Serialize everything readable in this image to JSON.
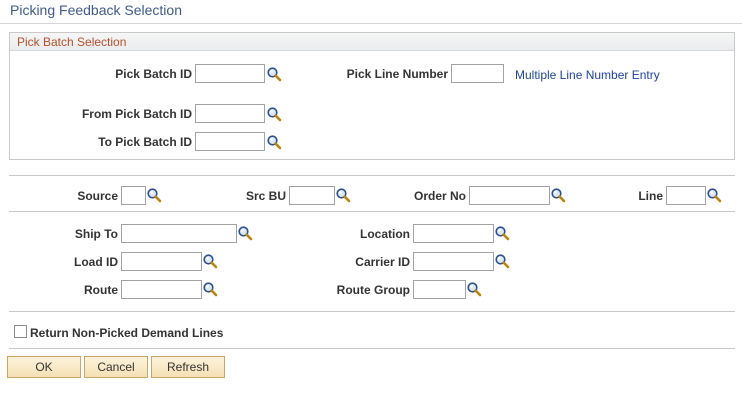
{
  "page": {
    "title": "Picking Feedback Selection"
  },
  "pick_batch_section": {
    "title": "Pick Batch Selection",
    "pick_batch_id_label": "Pick Batch ID",
    "pick_line_number_label": "Pick Line Number",
    "multiple_line_link": "Multiple Line Number Entry",
    "from_pick_batch_id_label": "From Pick Batch ID",
    "to_pick_batch_id_label": "To Pick Batch ID"
  },
  "source_row": {
    "source_label": "Source",
    "src_bu_label": "Src BU",
    "order_no_label": "Order No",
    "line_label": "Line"
  },
  "ship_section": {
    "ship_to_label": "Ship To",
    "location_label": "Location",
    "load_id_label": "Load ID",
    "carrier_id_label": "Carrier ID",
    "route_label": "Route",
    "route_group_label": "Route Group"
  },
  "options": {
    "return_non_picked_label": "Return Non-Picked Demand Lines",
    "return_non_picked_checked": false
  },
  "buttons": {
    "ok": "OK",
    "cancel": "Cancel",
    "refresh": "Refresh"
  },
  "colors": {
    "title": "#3f5a8a",
    "group_title": "#b5502a",
    "link": "#1f45a0",
    "button_bg": "#f5e0b4"
  },
  "icons": {
    "lookup": "magnifier-icon"
  }
}
